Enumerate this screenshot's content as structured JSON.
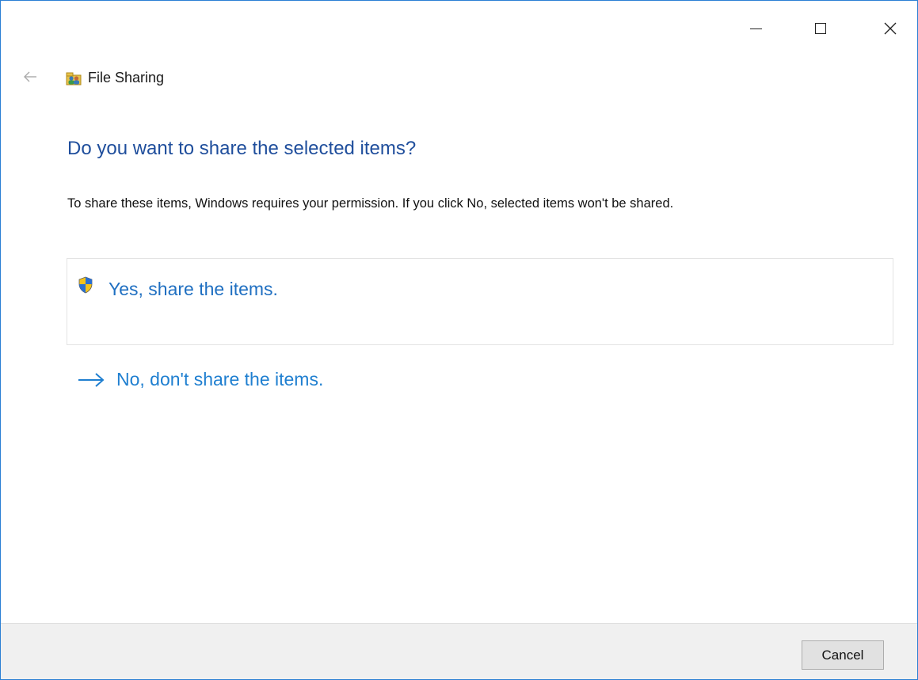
{
  "window": {
    "title": "File Sharing",
    "accent_color": "#2b7fd4",
    "caption_buttons": {
      "minimize_icon": "minimize-icon",
      "maximize_icon": "maximize-icon",
      "close_icon": "close-icon"
    }
  },
  "nav": {
    "back_icon": "back-arrow-icon"
  },
  "header": {
    "app_icon": "file-sharing-icon",
    "title": "File Sharing"
  },
  "content": {
    "heading": "Do you want to share the selected items?",
    "description": "To share these items, Windows requires your permission. If you click No, selected items won't be shared.",
    "options": {
      "yes": {
        "icon": "uac-shield-icon",
        "label": "Yes, share the items."
      },
      "no": {
        "icon": "arrow-right-icon",
        "label": "No, don't share the items."
      }
    }
  },
  "footer": {
    "cancel_label": "Cancel"
  }
}
